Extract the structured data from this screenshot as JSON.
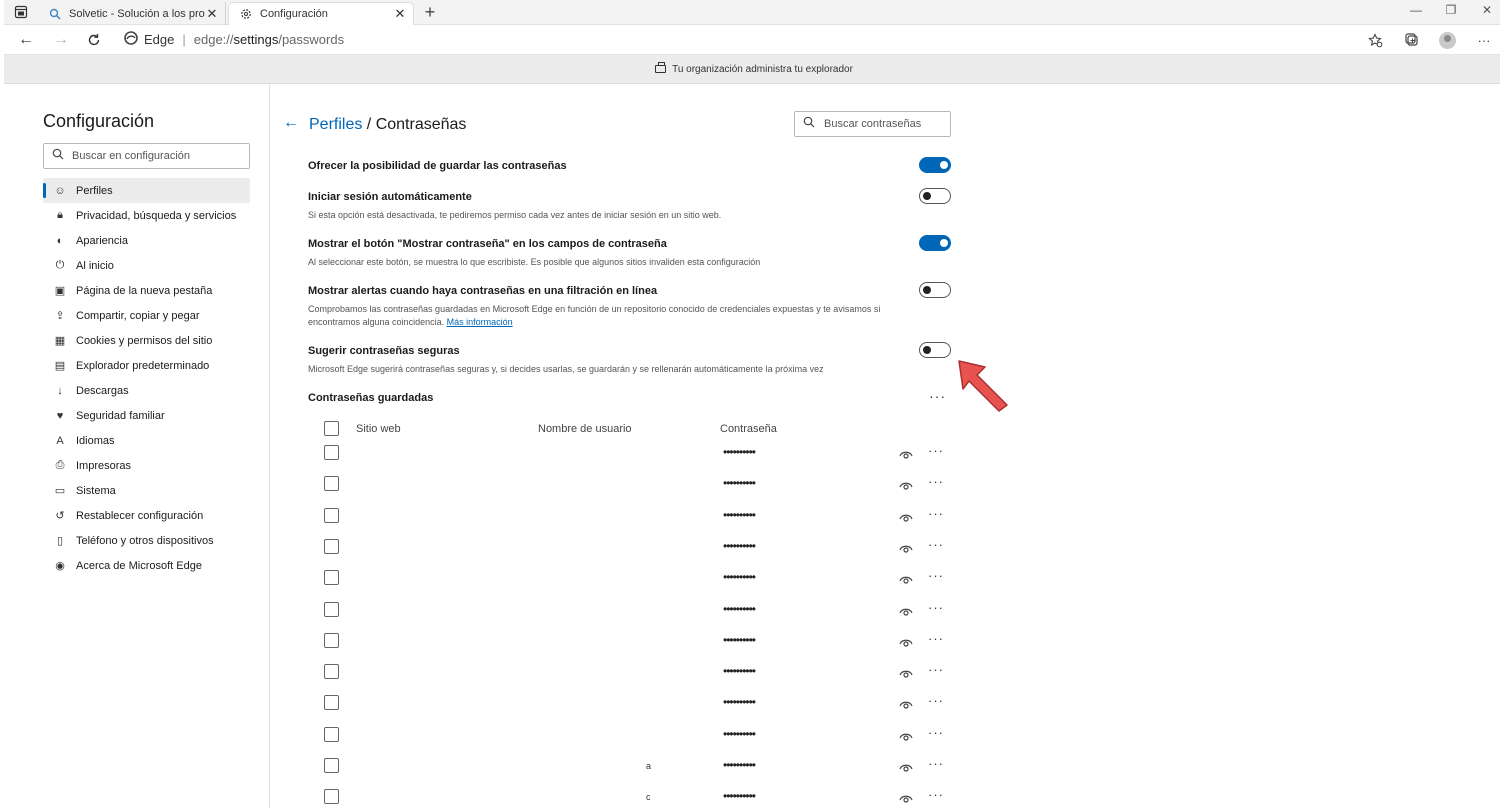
{
  "browser": {
    "tabs": [
      {
        "title": "Solvetic - Solución a los problem",
        "active": false
      },
      {
        "title": "Configuración",
        "active": true
      }
    ],
    "brand": "Edge",
    "url_prefix": "edge://",
    "url_highlight": "settings",
    "url_suffix": "/passwords",
    "managed_banner": "Tu organización administra tu explorador"
  },
  "sidebar": {
    "title": "Configuración",
    "search_placeholder": "Buscar en configuración",
    "items": [
      {
        "label": "Perfiles",
        "icon": "profile-icon",
        "active": true
      },
      {
        "label": "Privacidad, búsqueda y servicios",
        "icon": "lock-icon"
      },
      {
        "label": "Apariencia",
        "icon": "palette-icon"
      },
      {
        "label": "Al inicio",
        "icon": "power-icon"
      },
      {
        "label": "Página de la nueva pestaña",
        "icon": "newtab-icon"
      },
      {
        "label": "Compartir, copiar y pegar",
        "icon": "share-icon"
      },
      {
        "label": "Cookies y permisos del sitio",
        "icon": "cookies-icon"
      },
      {
        "label": "Explorador predeterminado",
        "icon": "browser-icon"
      },
      {
        "label": "Descargas",
        "icon": "download-icon"
      },
      {
        "label": "Seguridad familiar",
        "icon": "family-icon"
      },
      {
        "label": "Idiomas",
        "icon": "language-icon"
      },
      {
        "label": "Impresoras",
        "icon": "printer-icon"
      },
      {
        "label": "Sistema",
        "icon": "laptop-icon"
      },
      {
        "label": "Restablecer configuración",
        "icon": "reset-icon"
      },
      {
        "label": "Teléfono y otros dispositivos",
        "icon": "phone-icon"
      },
      {
        "label": "Acerca de Microsoft Edge",
        "icon": "edge-icon"
      }
    ]
  },
  "main": {
    "breadcrumb_parent": "Perfiles",
    "breadcrumb_sep": " / ",
    "breadcrumb_current": "Contraseñas",
    "search_placeholder": "Buscar contraseñas",
    "settings": [
      {
        "label": "Ofrecer la posibilidad de guardar las contraseñas",
        "desc": "",
        "on": true
      },
      {
        "label": "Iniciar sesión automáticamente",
        "desc": "Si esta opción está desactivada, te pediremos permiso cada vez antes de iniciar sesión en un sitio web.",
        "on": false
      },
      {
        "label": "Mostrar el botón \"Mostrar contraseña\" en los campos de contraseña",
        "desc": "Al seleccionar este botón, se muestra lo que escribiste. Es posible que algunos sitios invaliden esta configuración",
        "on": true
      },
      {
        "label": "Mostrar alertas cuando haya contraseñas en una filtración en línea",
        "desc": "Comprobamos las contraseñas guardadas en Microsoft Edge en función de un repositorio conocido de credenciales expuestas y te avisamos si encontramos alguna coincidencia.",
        "link": "Más información",
        "on": false
      },
      {
        "label": "Sugerir contraseñas seguras",
        "desc": "Microsoft Edge sugerirá contraseñas seguras y, si decides usarlas, se guardarán y se rellenarán automáticamente la próxima vez",
        "on": false
      }
    ],
    "saved_title": "Contraseñas guardadas",
    "table_headers": {
      "site": "Sitio web",
      "user": "Nombre de usuario",
      "password": "Contraseña"
    },
    "rows": [
      {
        "site": "",
        "user": "",
        "password": "••••••••••"
      },
      {
        "site": "",
        "user": "",
        "password": "••••••••••"
      },
      {
        "site": "",
        "user": "",
        "password": "••••••••••"
      },
      {
        "site": "",
        "user": "",
        "password": "••••••••••"
      },
      {
        "site": "",
        "user": "",
        "password": "••••••••••"
      },
      {
        "site": "",
        "user": "",
        "password": "••••••••••"
      },
      {
        "site": "",
        "user": "",
        "password": "••••••••••"
      },
      {
        "site": "",
        "user": "",
        "password": "••••••••••"
      },
      {
        "site": "",
        "user": "",
        "password": "••••••••••"
      },
      {
        "site": "",
        "user": "",
        "password": "••••••••••"
      },
      {
        "site": "",
        "user": "a",
        "password": "••••••••••"
      },
      {
        "site": "",
        "user": "c",
        "password": "••••••••••"
      }
    ]
  },
  "colors": {
    "accent": "#0067b8",
    "annotation_arrow": "#e8534f"
  }
}
